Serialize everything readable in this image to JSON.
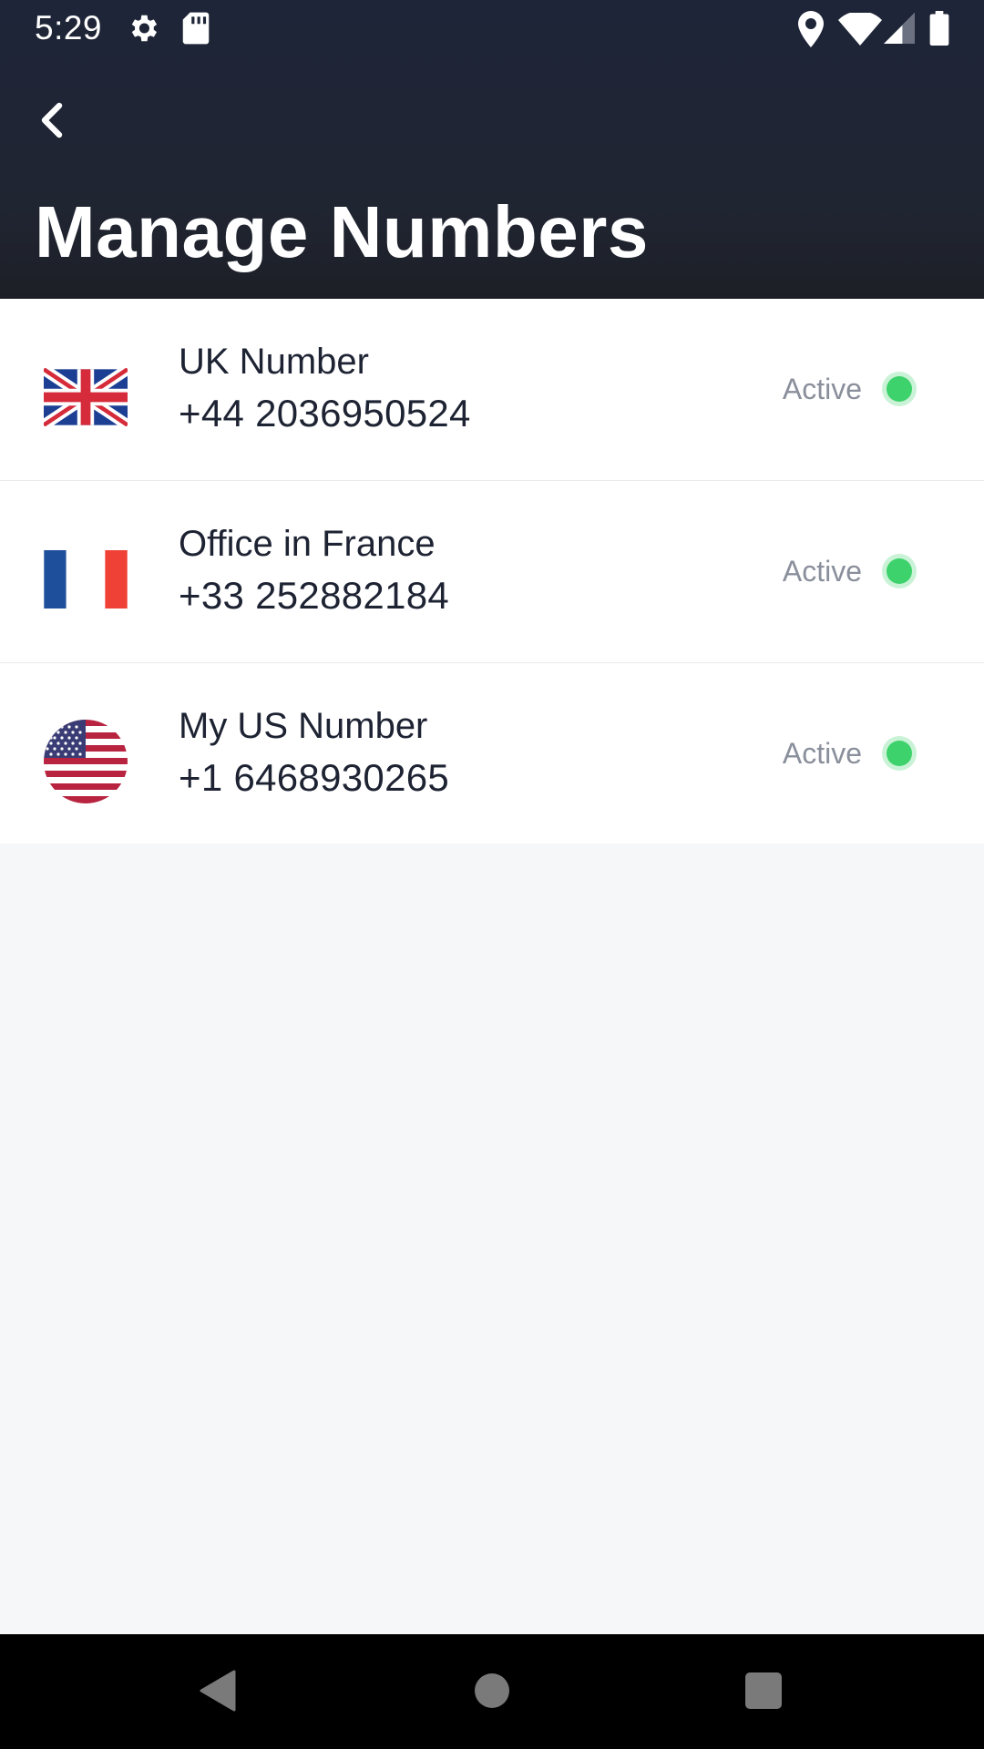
{
  "status_bar": {
    "time": "5:29",
    "left_icons": [
      "settings-icon",
      "sd-card-icon"
    ],
    "right_icons": [
      "location-icon",
      "wifi-icon",
      "signal-icon",
      "battery-icon"
    ]
  },
  "header": {
    "back_icon": "chevron-left-icon",
    "title": "Manage Numbers"
  },
  "numbers": [
    {
      "flag": "uk-flag-icon",
      "name": "UK Number",
      "number": "+44 2036950524",
      "status": "Active"
    },
    {
      "flag": "france-flag-icon",
      "name": "Office in France",
      "number": "+33 252882184",
      "status": "Active"
    },
    {
      "flag": "us-flag-icon",
      "name": "My US Number",
      "number": "+1 6468930265",
      "status": "Active"
    }
  ],
  "nav_bar": {
    "icons": [
      "back-triangle-icon",
      "home-circle-icon",
      "recents-square-icon"
    ]
  },
  "colors": {
    "header_bg": "#1e2538",
    "active_dot": "#3dd26b",
    "list_bg": "#ffffff",
    "page_bg": "#f6f7f9"
  }
}
